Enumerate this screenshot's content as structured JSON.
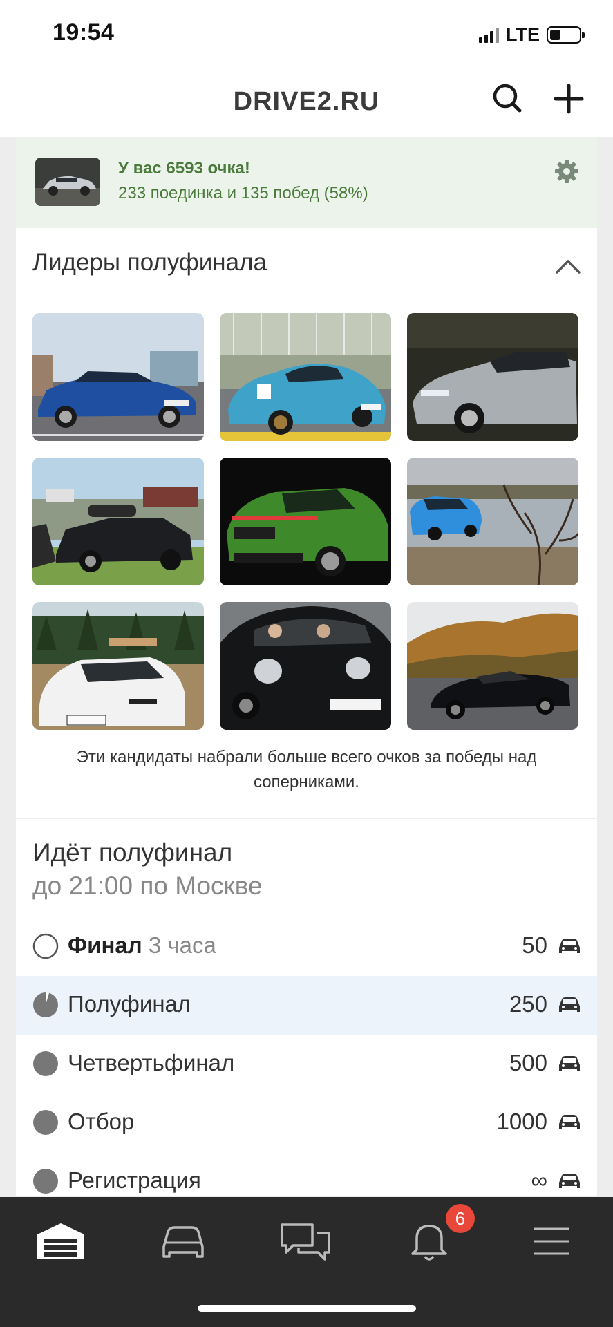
{
  "status_bar": {
    "time": "19:54",
    "network": "LTE",
    "battery_level": 0.38
  },
  "header": {
    "title": "DRIVE2.RU",
    "search_icon": "search-icon",
    "add_icon": "plus-icon"
  },
  "score": {
    "title": "У вас 6593 очка!",
    "subtitle": "233 поединка и 135 побед (58%)",
    "accent_color": "#4a7a3c",
    "settings_icon": "gear-icon"
  },
  "leaders": {
    "title": "Лидеры полуфинала",
    "collapse_icon": "chevron-up-icon",
    "note": "Эти кандидаты набрали больше всего очков за победы над соперниками.",
    "photos": [
      {
        "plate": ""
      },
      {
        "plate": "Т966РК"
      },
      {
        "plate": ""
      },
      {
        "plate": ""
      },
      {
        "plate": ""
      },
      {
        "plate": ""
      },
      {
        "plate": "Х468СЕ 198"
      },
      {
        "plate": "Н928РЕ 62"
      },
      {
        "plate": ""
      }
    ]
  },
  "rounds": {
    "title": "Идёт полуфинал",
    "subtitle": "до 21:00 по Москве",
    "items": [
      {
        "label": "Финал",
        "duration": "3 часа",
        "value": "50",
        "state": "upcoming"
      },
      {
        "label": "Полуфинал",
        "duration": "",
        "value": "250",
        "state": "current"
      },
      {
        "label": "Четвертьфинал",
        "duration": "",
        "value": "500",
        "state": "done"
      },
      {
        "label": "Отбор",
        "duration": "",
        "value": "1000",
        "state": "done"
      },
      {
        "label": "Регистрация",
        "duration": "",
        "value": "∞",
        "state": "done"
      }
    ]
  },
  "tab_bar": {
    "tabs": [
      "garage-icon",
      "car-icon",
      "messages-icon",
      "bell-icon",
      "menu-icon"
    ],
    "notifications_badge": "6",
    "badge_color": "#e8473a"
  }
}
